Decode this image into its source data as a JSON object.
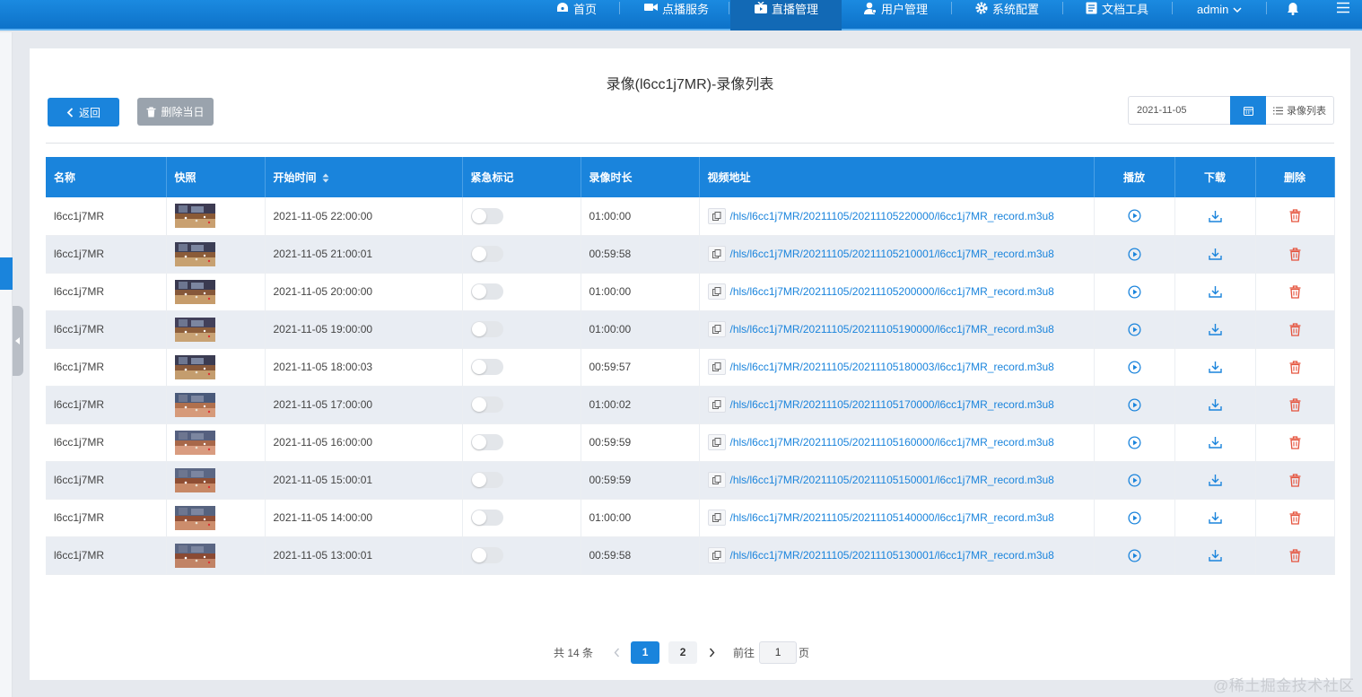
{
  "nav": {
    "home": "首页",
    "vod": "点播服务",
    "live": "直播管理",
    "users": "用户管理",
    "settings": "系统配置",
    "docs": "文档工具",
    "user": "admin"
  },
  "page": {
    "title": "录像(l6cc1j7MR)-录像列表",
    "back_label": "返回",
    "delete_day_label": "删除当日",
    "date_value": "2021-11-05",
    "list_label": "录像列表"
  },
  "table": {
    "columns": [
      "名称",
      "快照",
      "开始时间",
      "紧急标记",
      "录像时长",
      "视频地址",
      "播放",
      "下载",
      "删除"
    ],
    "rows": [
      {
        "name": "l6cc1j7MR",
        "start": "2021-11-05 22:00:00",
        "duration": "01:00:00",
        "url": "/hls/l6cc1j7MR/20211105/20211105220000/l6cc1j7MR_record.m3u8"
      },
      {
        "name": "l6cc1j7MR",
        "start": "2021-11-05 21:00:01",
        "duration": "00:59:58",
        "url": "/hls/l6cc1j7MR/20211105/20211105210001/l6cc1j7MR_record.m3u8"
      },
      {
        "name": "l6cc1j7MR",
        "start": "2021-11-05 20:00:00",
        "duration": "01:00:00",
        "url": "/hls/l6cc1j7MR/20211105/20211105200000/l6cc1j7MR_record.m3u8"
      },
      {
        "name": "l6cc1j7MR",
        "start": "2021-11-05 19:00:00",
        "duration": "01:00:00",
        "url": "/hls/l6cc1j7MR/20211105/20211105190000/l6cc1j7MR_record.m3u8"
      },
      {
        "name": "l6cc1j7MR",
        "start": "2021-11-05 18:00:03",
        "duration": "00:59:57",
        "url": "/hls/l6cc1j7MR/20211105/20211105180003/l6cc1j7MR_record.m3u8"
      },
      {
        "name": "l6cc1j7MR",
        "start": "2021-11-05 17:00:00",
        "duration": "01:00:02",
        "url": "/hls/l6cc1j7MR/20211105/20211105170000/l6cc1j7MR_record.m3u8"
      },
      {
        "name": "l6cc1j7MR",
        "start": "2021-11-05 16:00:00",
        "duration": "00:59:59",
        "url": "/hls/l6cc1j7MR/20211105/20211105160000/l6cc1j7MR_record.m3u8"
      },
      {
        "name": "l6cc1j7MR",
        "start": "2021-11-05 15:00:01",
        "duration": "00:59:59",
        "url": "/hls/l6cc1j7MR/20211105/20211105150001/l6cc1j7MR_record.m3u8"
      },
      {
        "name": "l6cc1j7MR",
        "start": "2021-11-05 14:00:00",
        "duration": "01:00:00",
        "url": "/hls/l6cc1j7MR/20211105/20211105140000/l6cc1j7MR_record.m3u8"
      },
      {
        "name": "l6cc1j7MR",
        "start": "2021-11-05 13:00:01",
        "duration": "00:59:58",
        "url": "/hls/l6cc1j7MR/20211105/20211105130001/l6cc1j7MR_record.m3u8"
      }
    ]
  },
  "pagination": {
    "total": "共 14 条",
    "page1": "1",
    "page2": "2",
    "goto": "前往",
    "current": "1",
    "page_suffix": "页"
  },
  "colors": {
    "primary": "#1a84dc",
    "delete": "#e5533d",
    "header": "#1a84dc"
  },
  "watermark": "@稀土掘金技术社区"
}
